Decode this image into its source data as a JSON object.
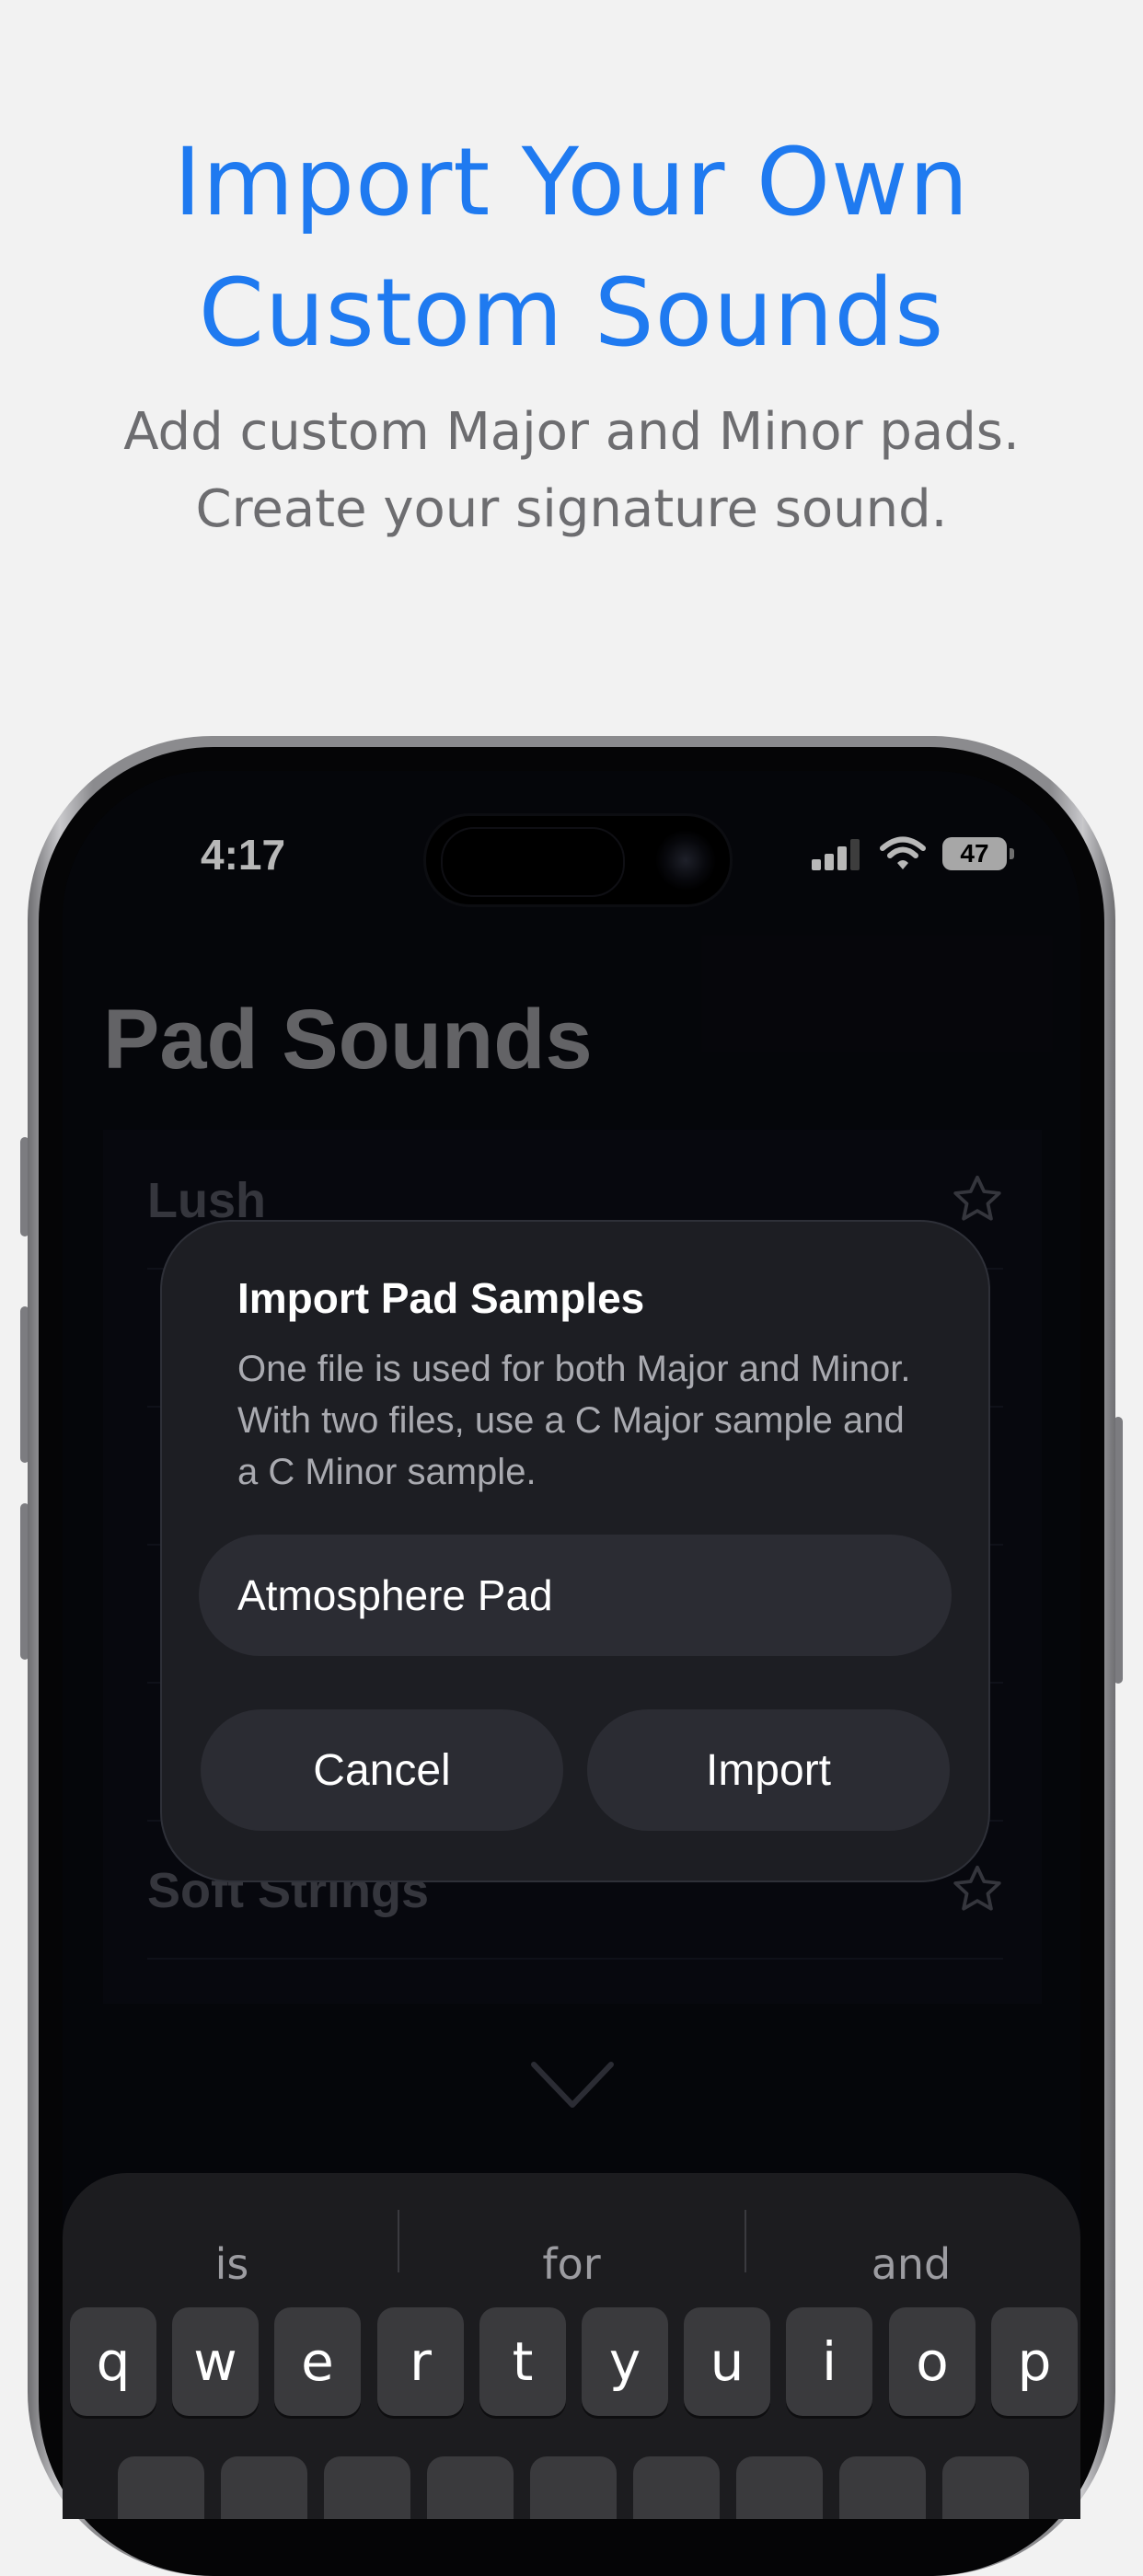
{
  "promo": {
    "headline_line1": "Import Your Own",
    "headline_line2": "Custom Sounds",
    "subtitle_line1": "Add custom Major and Minor pads.",
    "subtitle_line2": "Create your signature sound."
  },
  "status_bar": {
    "time": "4:17",
    "battery": "47"
  },
  "screen": {
    "title": "Pad Sounds",
    "list_items": [
      {
        "label": "Lush",
        "favorite": false
      },
      {
        "label": "",
        "favorite": false
      },
      {
        "label": "",
        "favorite": false
      },
      {
        "label": "",
        "favorite": false
      },
      {
        "label": "",
        "favorite": false
      },
      {
        "label": "Soft Strings",
        "favorite": false
      }
    ]
  },
  "dialog": {
    "title": "Import Pad Samples",
    "message": "One file is used for both Major and Minor. With two files, use a C Major sample and a C Minor sample.",
    "input_value": "Atmosphere Pad",
    "cancel_label": "Cancel",
    "import_label": "Import"
  },
  "keyboard": {
    "suggestions": [
      "is",
      "for",
      "and"
    ],
    "row1": [
      "q",
      "w",
      "e",
      "r",
      "t",
      "y",
      "u",
      "i",
      "o",
      "p"
    ]
  },
  "colors": {
    "accent": "#1f7af0",
    "background": "#f2f2f2",
    "screen_bg": "#08090f"
  }
}
